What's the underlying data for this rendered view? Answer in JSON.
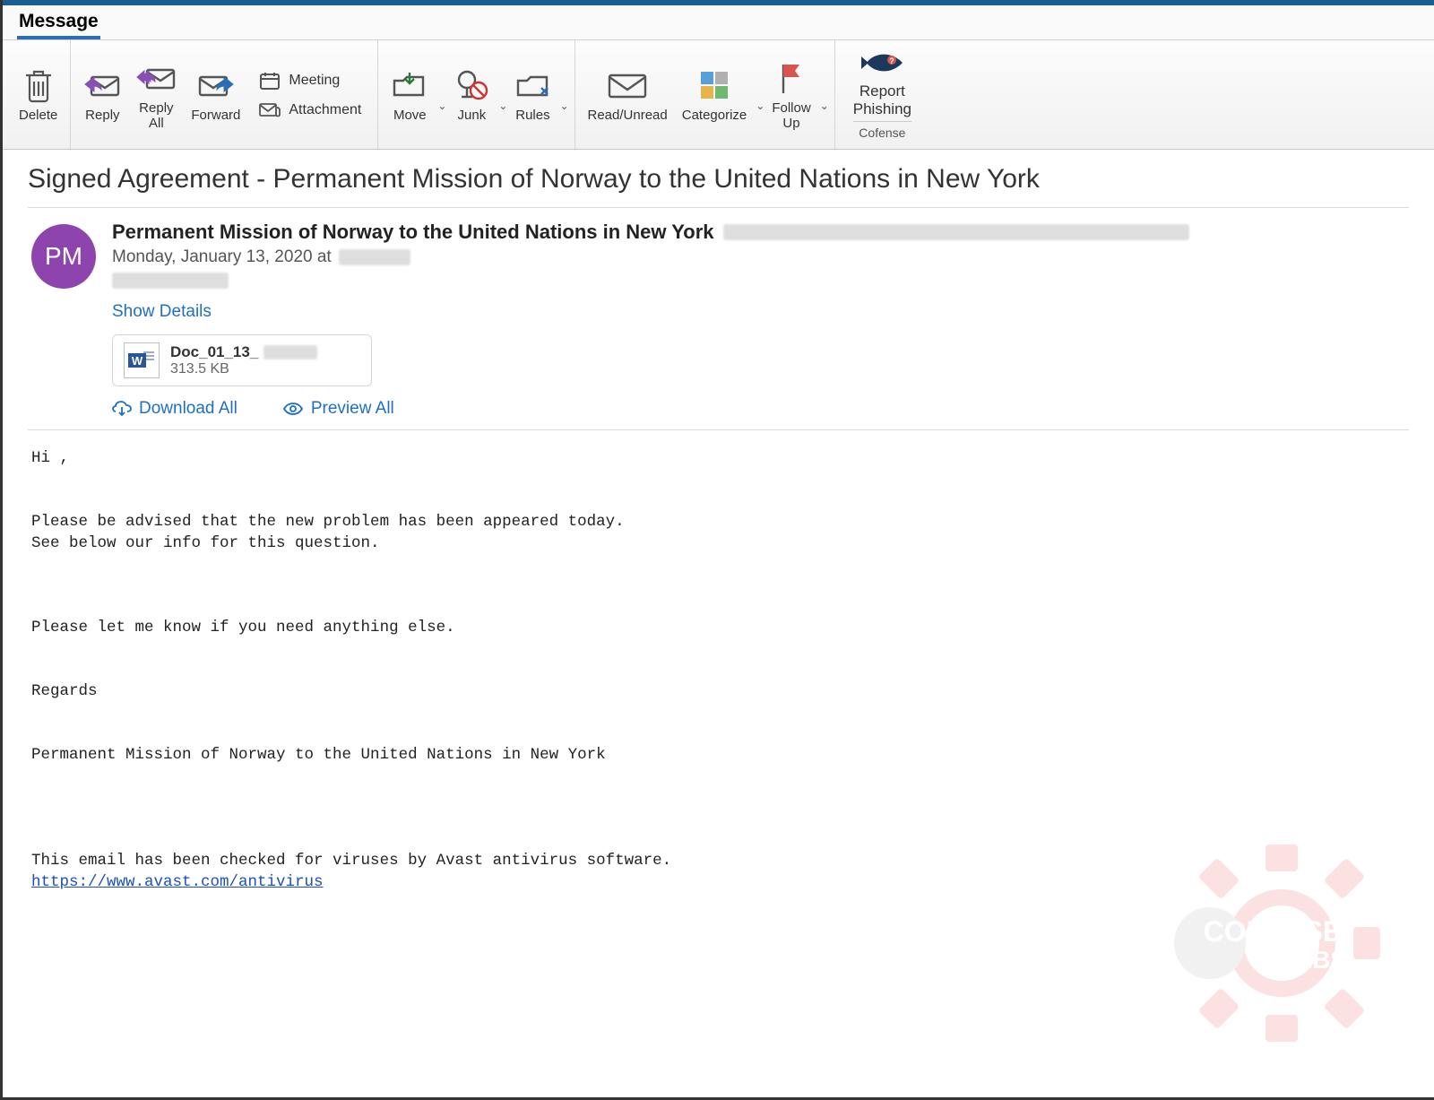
{
  "tabs": {
    "message": "Message"
  },
  "ribbon": {
    "delete": "Delete",
    "reply": "Reply",
    "reply_all": "Reply\nAll",
    "forward": "Forward",
    "meeting": "Meeting",
    "attachment": "Attachment",
    "move": "Move",
    "junk": "Junk",
    "rules": "Rules",
    "read_unread": "Read/Unread",
    "categorize": "Categorize",
    "follow_up": "Follow\nUp",
    "report_phishing": "Report\nPhishing",
    "cofense": "Cofense"
  },
  "email": {
    "subject": "Signed Agreement - Permanent Mission of Norway to the United Nations in New York",
    "sender": "Permanent Mission of Norway to the United Nations in New York",
    "avatar_initials": "PM",
    "date": "Monday, January 13, 2020 at",
    "show_details": "Show Details",
    "attachment": {
      "name_prefix": "Doc_01_13_",
      "size": "313.5 KB"
    },
    "download_all": "Download All",
    "preview_all": "Preview All",
    "body_greeting": "Hi ,",
    "body_p1": "Please be advised that the new problem has been appeared today.\nSee below our info for this question.",
    "body_p2": "Please let me know if you need anything else.",
    "body_regards": "Regards",
    "body_signature": "Permanent Mission of Norway to the United Nations in New York",
    "body_antivirus": "This email has been checked for viruses by Avast antivirus software.",
    "body_antivirus_link": "https://www.avast.com/antivirus"
  },
  "watermark_text": "COFENSE\nLABS"
}
